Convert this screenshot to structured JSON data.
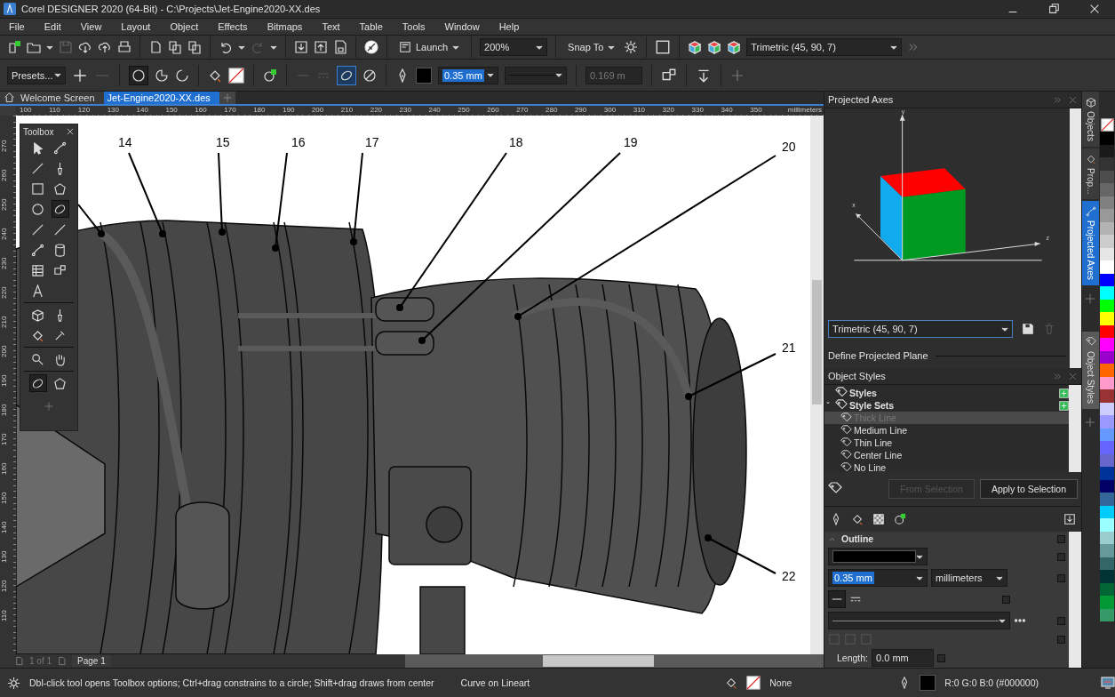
{
  "window": {
    "title": "Corel DESIGNER 2020 (64-Bit) - C:\\Projects\\Jet-Engine2020-XX.des"
  },
  "menu": [
    "File",
    "Edit",
    "View",
    "Layout",
    "Object",
    "Effects",
    "Bitmaps",
    "Text",
    "Table",
    "Tools",
    "Window",
    "Help"
  ],
  "toolbar": {
    "launch": "Launch",
    "zoom": "200%",
    "snap": "Snap To",
    "projection": "Trimetric (45, 90, 7)"
  },
  "property_bar": {
    "presets": "Presets...",
    "outline_width": "0.35 mm",
    "spacing": "0.169 m"
  },
  "document_tabs": [
    {
      "label": "Welcome Screen",
      "selected": false
    },
    {
      "label": "Jet-Engine2020-XX.des",
      "selected": true
    }
  ],
  "ruler": {
    "horizontal": [
      "100",
      "110",
      "120",
      "130",
      "140",
      "150",
      "160",
      "170",
      "180",
      "190",
      "200",
      "210",
      "220",
      "230",
      "240",
      "250",
      "260",
      "270",
      "280",
      "290",
      "300",
      "310",
      "320",
      "330",
      "340",
      "350"
    ],
    "unit": "millimeters",
    "vertical": [
      "270",
      "260",
      "250",
      "240",
      "230",
      "220",
      "210",
      "200",
      "190",
      "180",
      "170",
      "160",
      "150",
      "140",
      "130",
      "120",
      "110"
    ]
  },
  "toolbox": {
    "title": "Toolbox"
  },
  "drawing": {
    "callouts": [
      "14",
      "15",
      "16",
      "17",
      "18",
      "19",
      "20",
      "21",
      "22"
    ]
  },
  "page_nav": {
    "count": "1 of 1",
    "page_tab": "Page 1"
  },
  "projected_axes": {
    "title": "Projected Axes",
    "axis_labels": [
      "y",
      "x",
      "z"
    ],
    "preset": "Trimetric (45, 90, 7)",
    "section": "Define Projected Plane"
  },
  "object_styles": {
    "title": "Object Styles",
    "tree": [
      {
        "label": "Styles",
        "expanded": false
      },
      {
        "label": "Style Sets",
        "expanded": true,
        "children": [
          {
            "label": "Thick Line",
            "selected": true
          },
          {
            "label": "Medium Line",
            "selected": false
          },
          {
            "label": "Thin Line",
            "selected": false
          },
          {
            "label": "Center Line",
            "selected": false
          },
          {
            "label": "No Line",
            "selected": false
          }
        ]
      }
    ],
    "buttons": [
      {
        "label": "From Selection",
        "disabled": true
      },
      {
        "label": "Apply to Selection",
        "disabled": false
      }
    ],
    "outline": {
      "title": "Outline",
      "expanded": true,
      "width": "0.35 mm",
      "units": "millimeters",
      "length_label": "Length:",
      "length": "0.0 mm",
      "checks": [
        {
          "checked": false
        },
        {
          "checked": false
        },
        {
          "checked": false
        },
        {
          "checked": false
        },
        {
          "checked": false
        },
        {
          "checked": false
        },
        {
          "checked": false
        }
      ]
    }
  },
  "docker_tabs_top": [
    {
      "label": "Objects",
      "selected": false
    },
    {
      "label": "Prop...",
      "selected": false
    },
    {
      "label": "Projected Axes",
      "selected": true
    }
  ],
  "docker_tabs_bottom": [
    {
      "label": "Object Styles",
      "selected": true
    }
  ],
  "palette": [
    {
      "kind": "none"
    },
    {
      "kind": "color",
      "color": "#000000"
    },
    {
      "kind": "color",
      "color": "#1a1a1a"
    },
    {
      "kind": "color",
      "color": "#333333"
    },
    {
      "kind": "color",
      "color": "#4d4d4d"
    },
    {
      "kind": "color",
      "color": "#666666"
    },
    {
      "kind": "color",
      "color": "#808080"
    },
    {
      "kind": "color",
      "color": "#999999"
    },
    {
      "kind": "color",
      "color": "#b3b3b3"
    },
    {
      "kind": "color",
      "color": "#cccccc"
    },
    {
      "kind": "color",
      "color": "#e6e6e6"
    },
    {
      "kind": "color",
      "color": "#ffffff"
    },
    {
      "kind": "color",
      "color": "#0000ff"
    },
    {
      "kind": "color",
      "color": "#00ffff"
    },
    {
      "kind": "color",
      "color": "#00ff00"
    },
    {
      "kind": "color",
      "color": "#ffff00"
    },
    {
      "kind": "color",
      "color": "#ff0000"
    },
    {
      "kind": "color",
      "color": "#ff00ff"
    },
    {
      "kind": "color",
      "color": "#9900cc"
    },
    {
      "kind": "color",
      "color": "#ff6600"
    },
    {
      "kind": "color",
      "color": "#ff99cc"
    },
    {
      "kind": "color",
      "color": "#993333"
    },
    {
      "kind": "color",
      "color": "#ccccff"
    },
    {
      "kind": "color",
      "color": "#9999ff"
    },
    {
      "kind": "color",
      "color": "#6699ff"
    },
    {
      "kind": "color",
      "color": "#6666ff"
    },
    {
      "kind": "color",
      "color": "#6666cc"
    },
    {
      "kind": "color",
      "color": "#003399"
    },
    {
      "kind": "color",
      "color": "#000066"
    },
    {
      "kind": "color",
      "color": "#336699"
    },
    {
      "kind": "color",
      "color": "#00ccff"
    },
    {
      "kind": "color",
      "color": "#99ffff"
    },
    {
      "kind": "color",
      "color": "#99cccc"
    },
    {
      "kind": "color",
      "color": "#669999"
    },
    {
      "kind": "color",
      "color": "#336666"
    },
    {
      "kind": "color",
      "color": "#003333"
    },
    {
      "kind": "color",
      "color": "#006633"
    },
    {
      "kind": "color",
      "color": "#009933"
    },
    {
      "kind": "color",
      "color": "#339966"
    }
  ],
  "status_bar": {
    "hint": "Dbl-click tool opens Toolbox options; Ctrl+drag constrains to a circle; Shift+drag draws from center",
    "object_info": "Curve on Lineart",
    "fill": "None",
    "outline": "R:0 G:0 B:0 (#000000)"
  }
}
